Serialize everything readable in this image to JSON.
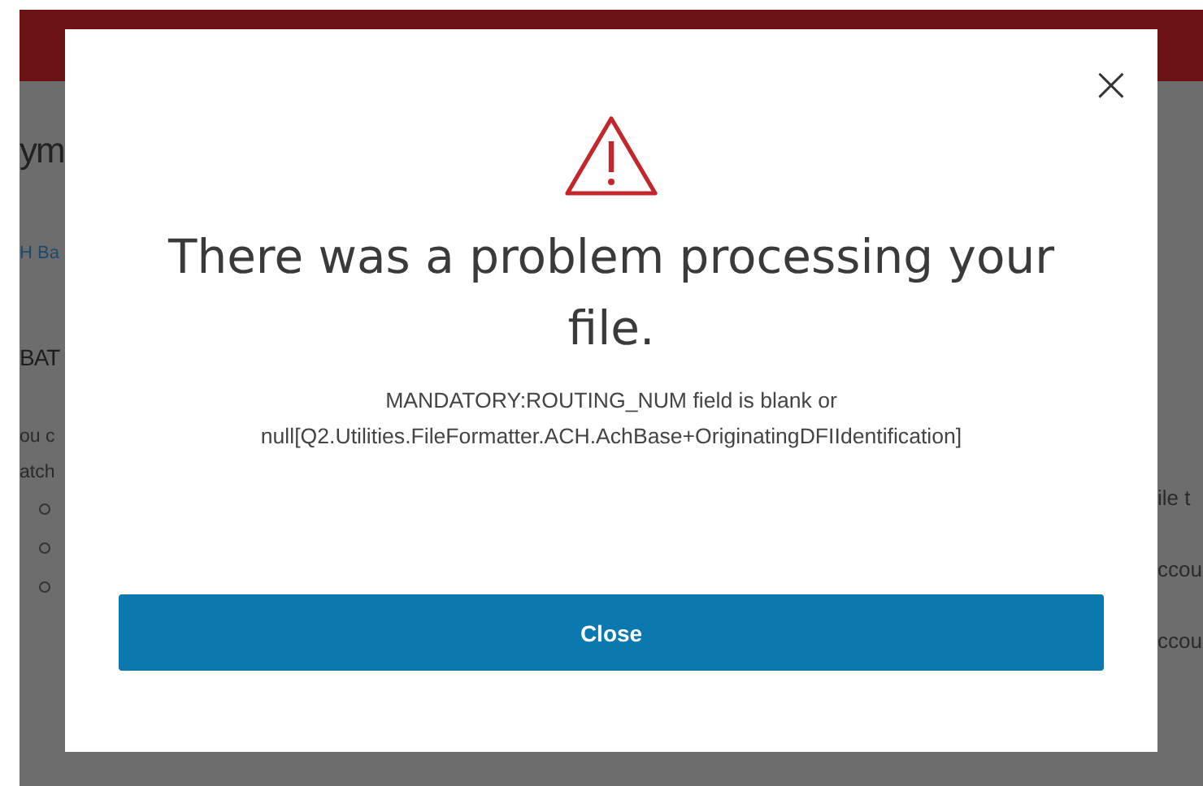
{
  "background_page": {
    "heading": "ym",
    "link": "H Ba",
    "section_title": "BAT",
    "left_lines": [
      "ou c",
      "atch"
    ],
    "right_lines": [
      "ile t",
      "ccou",
      "ccou"
    ]
  },
  "dialog": {
    "close_symbol": "×",
    "title": "There was a problem processing your file.",
    "message": "MANDATORY:ROUTING_NUM field is blank or null[Q2.Utilities.FileFormatter.ACH.AchBase+OriginatingDFIIdentification]",
    "button": "Close"
  }
}
